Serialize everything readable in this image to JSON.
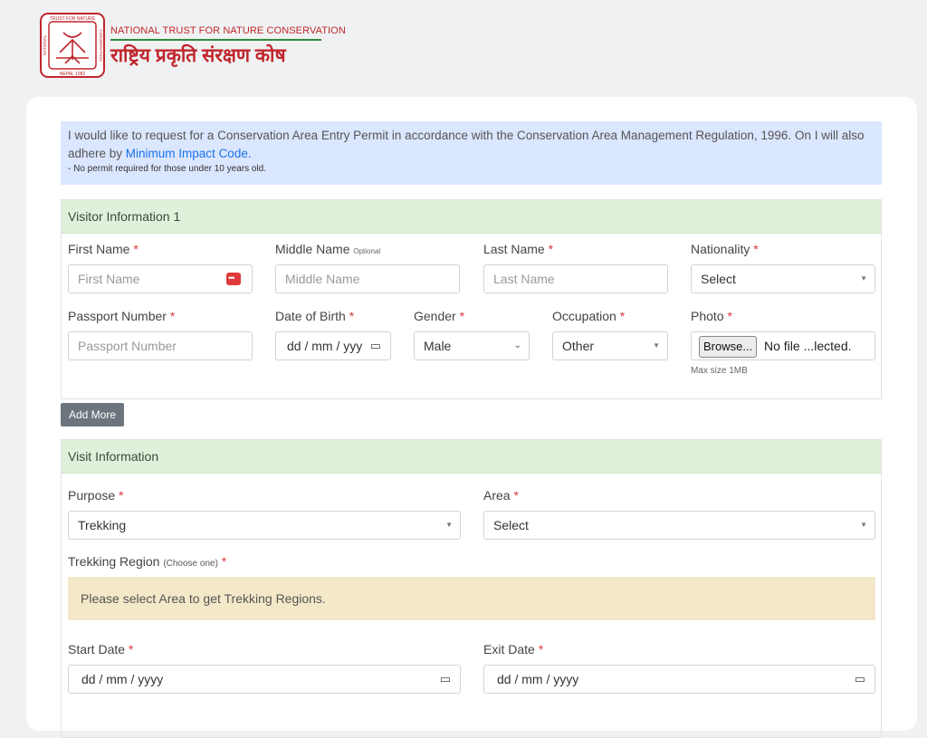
{
  "header": {
    "brand_en": "NATIONAL TRUST FOR NATURE CONSERVATION",
    "brand_ne": "राष्ट्रिय प्रकृति संरक्षण कोष",
    "logo_text_top": "TRUST FOR NATURE",
    "logo_text_left": "NATIONAL",
    "logo_text_right": "CONSERVATION",
    "logo_text_bottom": "NEPAL 1982"
  },
  "notice": {
    "text": "I would like to request for a Conservation Area Entry Permit in accordance with the Conservation Area Management Regulation, 1996. On I will also adhere by ",
    "link": "Minimum Impact Code.",
    "note": "- No permit required for those under 10 years old."
  },
  "visitor": {
    "title": "Visitor Information 1",
    "first_name_label": "First Name",
    "first_name_placeholder": "First Name",
    "middle_name_label": "Middle Name",
    "optional": "Optional",
    "middle_name_placeholder": "Middle Name",
    "last_name_label": "Last Name",
    "last_name_placeholder": "Last Name",
    "nationality_label": "Nationality",
    "nationality_value": "Select",
    "passport_label": "Passport Number",
    "passport_placeholder": "Passport Number",
    "dob_label": "Date of Birth",
    "dob_placeholder": "dd / mm / yyy",
    "gender_label": "Gender",
    "gender_value": "Male",
    "occupation_label": "Occupation",
    "occupation_value": "Other",
    "photo_label": "Photo",
    "browse_label": "Browse...",
    "file_text": "No file ...lected.",
    "max_size": "Max size 1MB",
    "required": "*"
  },
  "add_more": "Add More",
  "visit": {
    "title": "Visit Information",
    "purpose_label": "Purpose",
    "purpose_value": "Trekking",
    "area_label": "Area",
    "area_value": "Select",
    "region_label": "Trekking Region",
    "region_hint": "(Choose one)",
    "region_message": "Please select Area to get Trekking Regions.",
    "start_label": "Start Date",
    "start_placeholder": "dd / mm / yyyy",
    "exit_label": "Exit Date",
    "exit_placeholder": "dd / mm / yyyy"
  },
  "colors": {
    "brand_red": "#c0262d",
    "notice_bg": "#dbe6ff",
    "section_head_bg": "#e0f0da",
    "warning_bg": "#f3e8c8",
    "required_red": "#d9383a"
  }
}
